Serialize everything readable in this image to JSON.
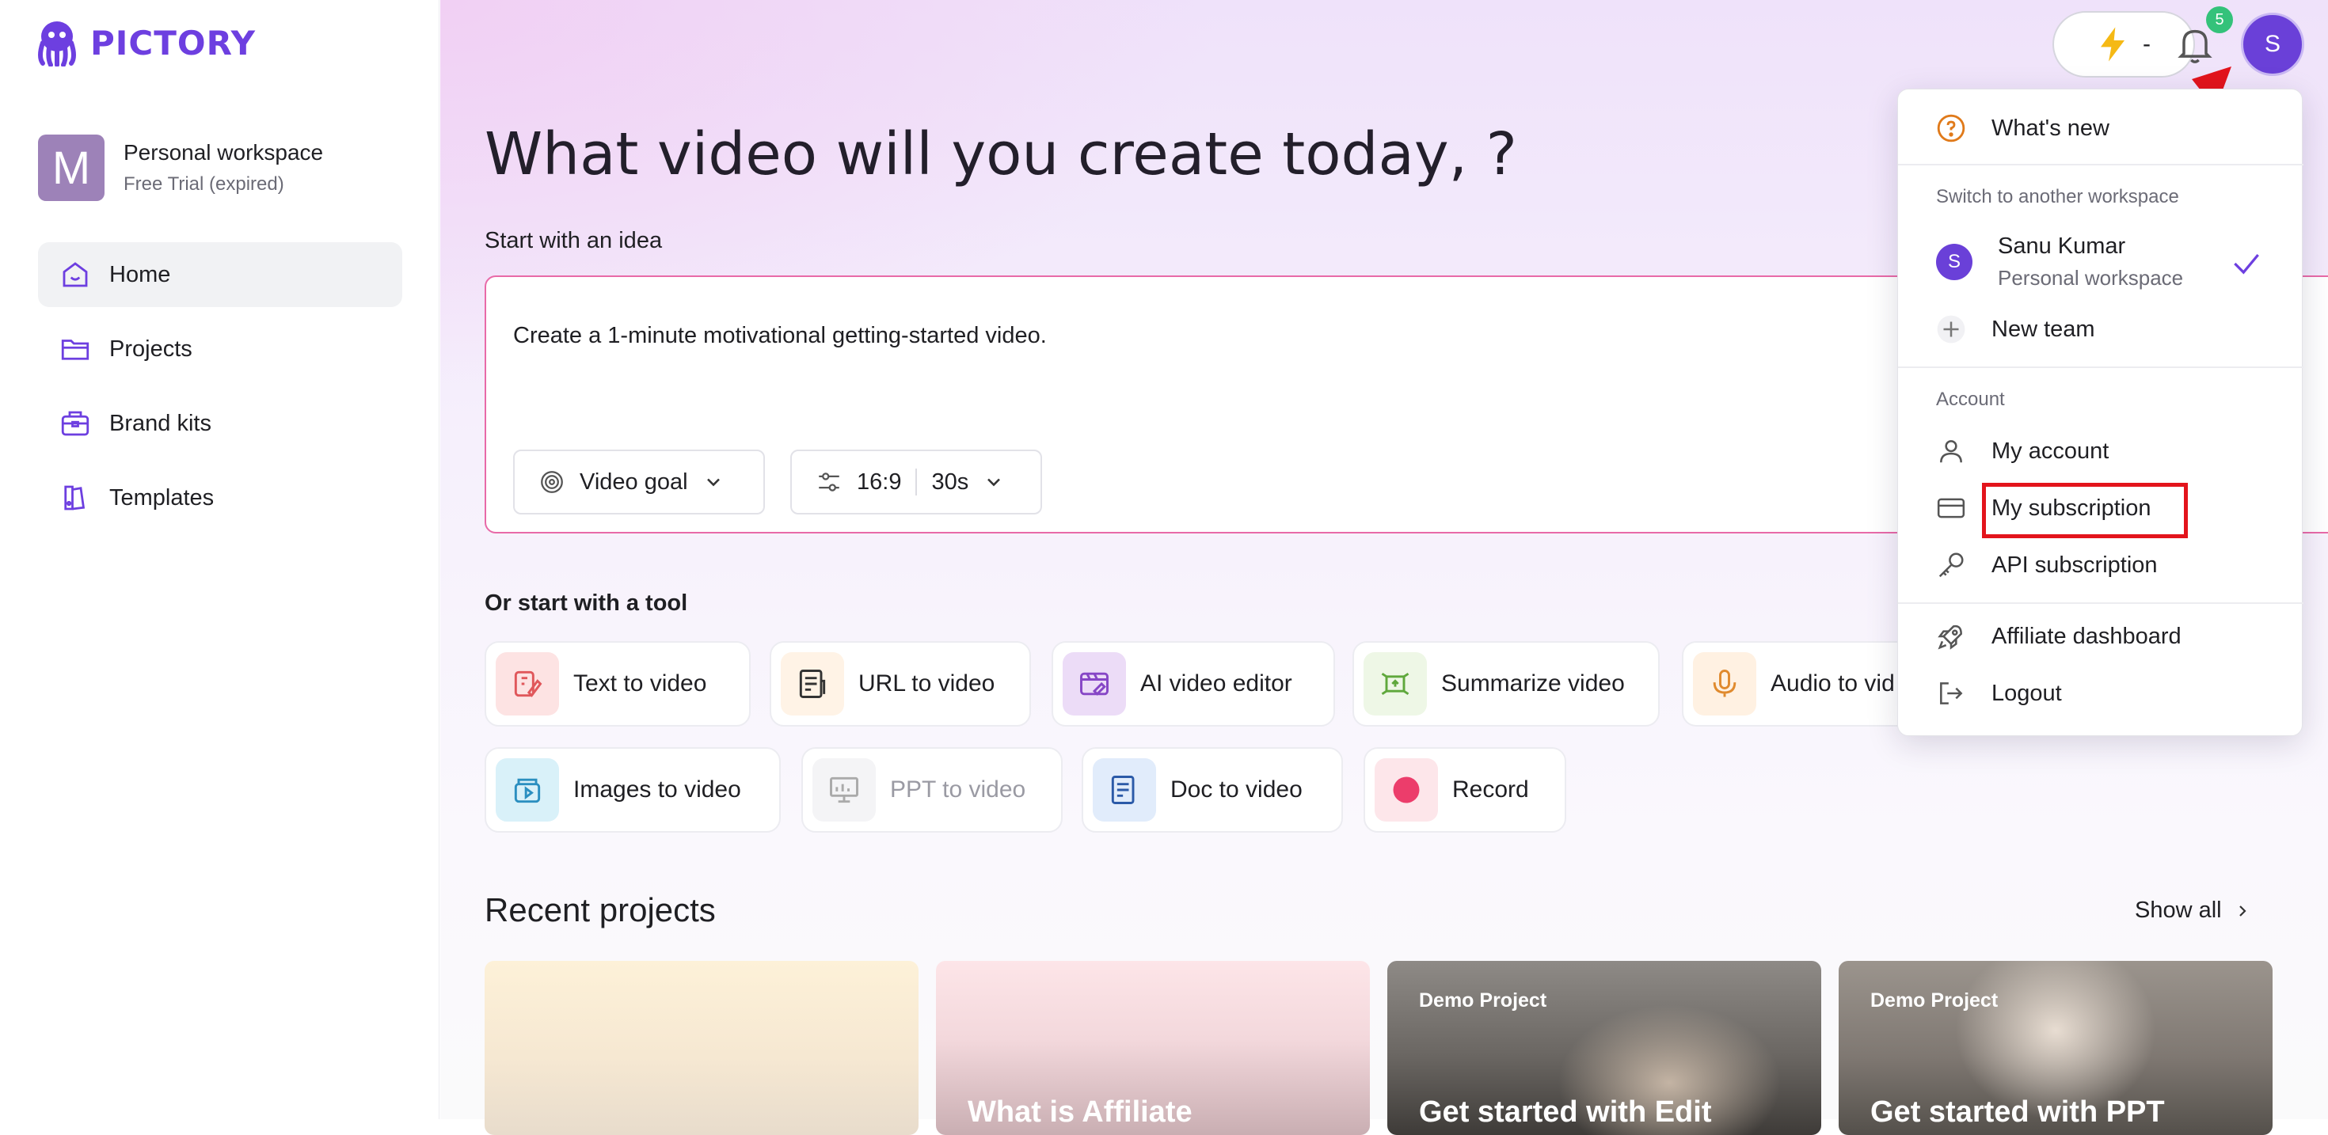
{
  "sidebar": {
    "logo_text": "PICTORY",
    "workspace": {
      "avatar_letter": "M",
      "name": "Personal workspace",
      "status": "Free Trial (expired)"
    },
    "nav": [
      {
        "label": "Home",
        "icon": "home-icon",
        "active": true
      },
      {
        "label": "Projects",
        "icon": "folder-icon"
      },
      {
        "label": "Brand kits",
        "icon": "briefcase-icon"
      },
      {
        "label": "Templates",
        "icon": "templates-icon"
      }
    ]
  },
  "main": {
    "title": "What video will you create today, ?",
    "idea_label": "Start with an idea",
    "idea_text": "Create a 1-minute motivational getting-started video.",
    "video_goal_label": "Video goal",
    "aspect_ratio": "16:9",
    "duration": "30s",
    "tool_label": "Or start with a tool",
    "tools": [
      {
        "label": "Text to video",
        "icon": "text-to-video-icon"
      },
      {
        "label": "URL to video",
        "icon": "url-to-video-icon"
      },
      {
        "label": "AI video editor",
        "icon": "ai-video-editor-icon"
      },
      {
        "label": "Summarize video",
        "icon": "summarize-video-icon"
      },
      {
        "label": "Audio to vid",
        "icon": "microphone-icon"
      },
      {
        "label": "Images to video",
        "icon": "images-to-video-icon"
      },
      {
        "label": "PPT to video",
        "icon": "ppt-to-video-icon",
        "disabled": true
      },
      {
        "label": "Doc to video",
        "icon": "doc-to-video-icon"
      },
      {
        "label": "Record",
        "icon": "record-icon"
      }
    ],
    "recent_title": "Recent projects",
    "show_all": "Show all",
    "projects": [
      {
        "tag": "",
        "title": ""
      },
      {
        "tag": "",
        "title": "What is Affiliate"
      },
      {
        "tag": "Demo Project",
        "title": "Get started with Edit"
      },
      {
        "tag": "Demo Project",
        "title": "Get started with PPT"
      }
    ]
  },
  "topbar": {
    "credits": "-",
    "notification_count": "5",
    "user_initial": "S"
  },
  "menu": {
    "whats_new": "What's new",
    "switch_label": "Switch to another workspace",
    "user_initial": "S",
    "user_name": "Sanu Kumar",
    "user_workspace": "Personal workspace",
    "new_team": "New team",
    "account_label": "Account",
    "my_account": "My account",
    "my_subscription": "My subscription",
    "api_subscription": "API subscription",
    "affiliate": "Affiliate dashboard",
    "logout": "Logout"
  },
  "colors": {
    "brand": "#6d3fe0",
    "highlight": "#e3141c",
    "badge": "#34c27a"
  }
}
